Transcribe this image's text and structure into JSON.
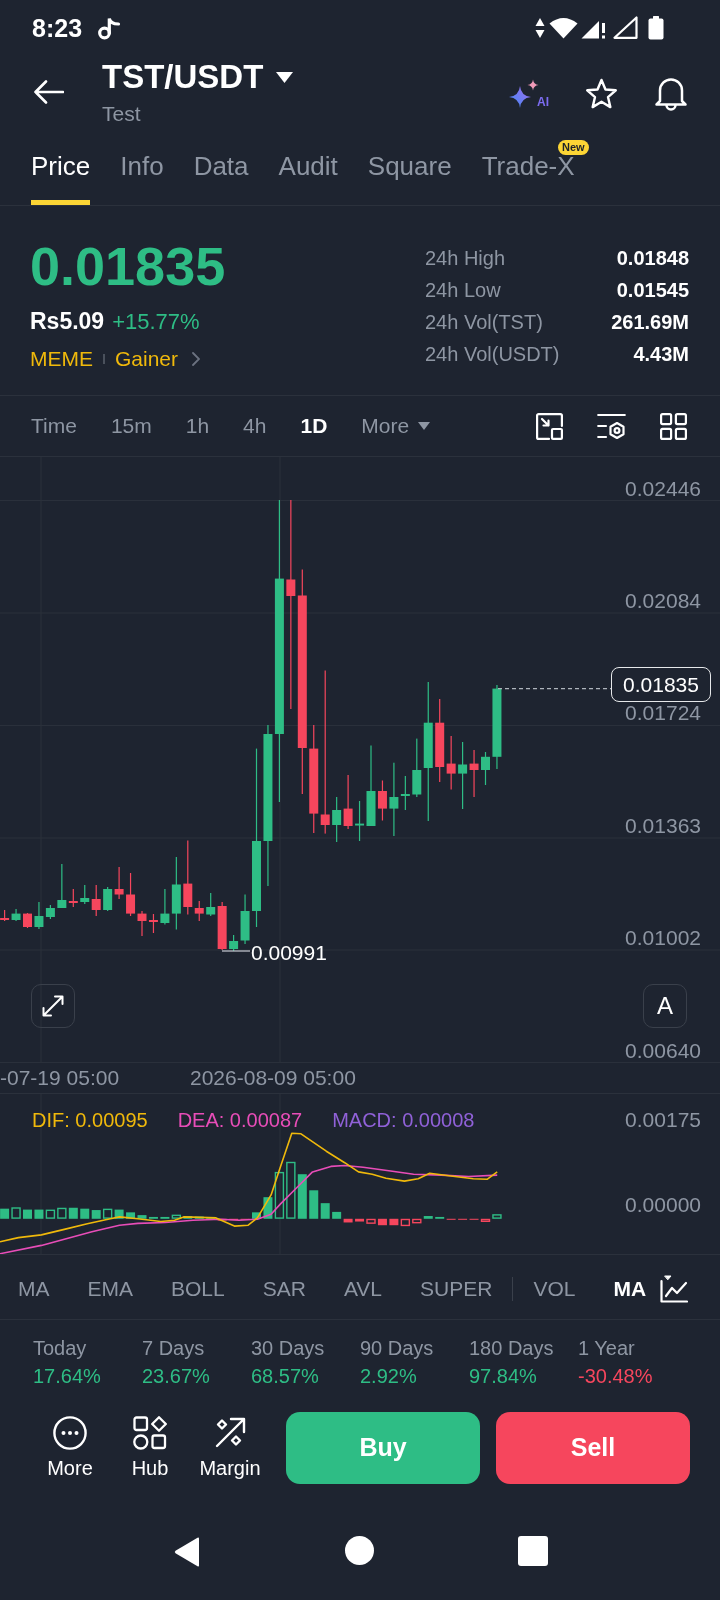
{
  "status_bar": {
    "time": "8:23"
  },
  "header": {
    "pair": "TST/USDT",
    "name": "Test",
    "ai_label": "AI"
  },
  "tabs": [
    {
      "label": "Price",
      "selected": true
    },
    {
      "label": "Info",
      "selected": false
    },
    {
      "label": "Data",
      "selected": false
    },
    {
      "label": "Audit",
      "selected": false
    },
    {
      "label": "Square",
      "selected": false
    },
    {
      "label": "Trade-X",
      "selected": false,
      "badge": "New"
    }
  ],
  "ticker": {
    "last_price": "0.01835",
    "rising": true,
    "fiat_price": "Rs5.09",
    "change": "+15.77%",
    "tags": [
      "MEME",
      "Gainer"
    ]
  },
  "stats": [
    {
      "label": "24h High",
      "value": "0.01848"
    },
    {
      "label": "24h Low",
      "value": "0.01545"
    },
    {
      "label": "24h Vol(TST)",
      "value": "261.69M"
    },
    {
      "label": "24h Vol(USDT)",
      "value": "4.43M"
    }
  ],
  "intervals": [
    {
      "label": "Time",
      "selected": false
    },
    {
      "label": "15m",
      "selected": false
    },
    {
      "label": "1h",
      "selected": false
    },
    {
      "label": "4h",
      "selected": false
    },
    {
      "label": "1D",
      "selected": true
    }
  ],
  "more_intervals": "More",
  "chart": {
    "price_axis": [
      "0.02446",
      "0.02084",
      "0.01724",
      "0.01363",
      "0.01002",
      "0.00640"
    ],
    "last_price": "0.01835",
    "low_label": "0.00991",
    "time_axis": [
      "-07-19 05:00",
      "2026-08-09 05:00"
    ],
    "scale_button": "A"
  },
  "macd": {
    "legend": [
      {
        "label": "DIF: 0.00095",
        "color": "#f0b90b"
      },
      {
        "label": "DEA: 0.00087",
        "color": "#e84db8"
      },
      {
        "label": "MACD: 0.00008",
        "color": "#9061d8"
      }
    ],
    "axis": [
      "0.00175",
      "0.00000"
    ]
  },
  "indicators": {
    "main": [
      {
        "label": "MA",
        "selected": false
      },
      {
        "label": "EMA",
        "selected": false
      },
      {
        "label": "BOLL",
        "selected": false
      },
      {
        "label": "SAR",
        "selected": false
      },
      {
        "label": "AVL",
        "selected": false
      },
      {
        "label": "SUPER",
        "selected": false
      }
    ],
    "sub": [
      {
        "label": "VOL",
        "selected": false
      },
      {
        "label": "MA",
        "selected": true
      }
    ]
  },
  "performance": [
    {
      "period": "Today",
      "change": "17.64%",
      "positive": true
    },
    {
      "period": "7 Days",
      "change": "23.67%",
      "positive": true
    },
    {
      "period": "30 Days",
      "change": "68.57%",
      "positive": true
    },
    {
      "period": "90 Days",
      "change": "2.92%",
      "positive": true
    },
    {
      "period": "180 Days",
      "change": "97.84%",
      "positive": true
    },
    {
      "period": "1 Year",
      "change": "-30.48%",
      "positive": false
    }
  ],
  "actions": [
    {
      "label": "More"
    },
    {
      "label": "Hub"
    },
    {
      "label": "Margin"
    }
  ],
  "trade": {
    "buy": "Buy",
    "sell": "Sell"
  }
}
